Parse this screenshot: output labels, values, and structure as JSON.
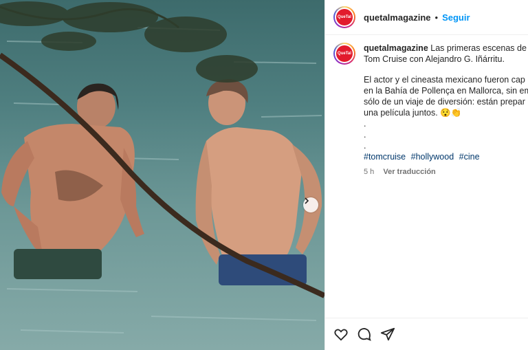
{
  "post": {
    "image_description_icon": "photo",
    "next_icon": "chevron-right-icon"
  },
  "header": {
    "avatar_text": "QueTal",
    "username": "quetalmagazine",
    "separator": "•",
    "follow_label": "Seguir"
  },
  "caption": {
    "username": "quetalmagazine",
    "line1": "Las primeras escenas de",
    "line2": "Tom Cruise con Alejandro G. Iñárritu.",
    "body1": "El actor y el cineasta mexicano fueron cap",
    "body2": "en la Bahía de Pollença en Mallorca, sin em",
    "body3": "sólo de un viaje de diversión: están prepar",
    "body4": "una película juntos. 😯👏",
    "dots": [
      ".",
      ".",
      "."
    ],
    "hashtags": [
      "#tomcruise",
      "#hollywood",
      "#cine"
    ]
  },
  "meta": {
    "time": "5 h",
    "translate": "Ver traducción"
  },
  "actions": [
    "heart-icon",
    "comment-icon",
    "share-icon"
  ]
}
